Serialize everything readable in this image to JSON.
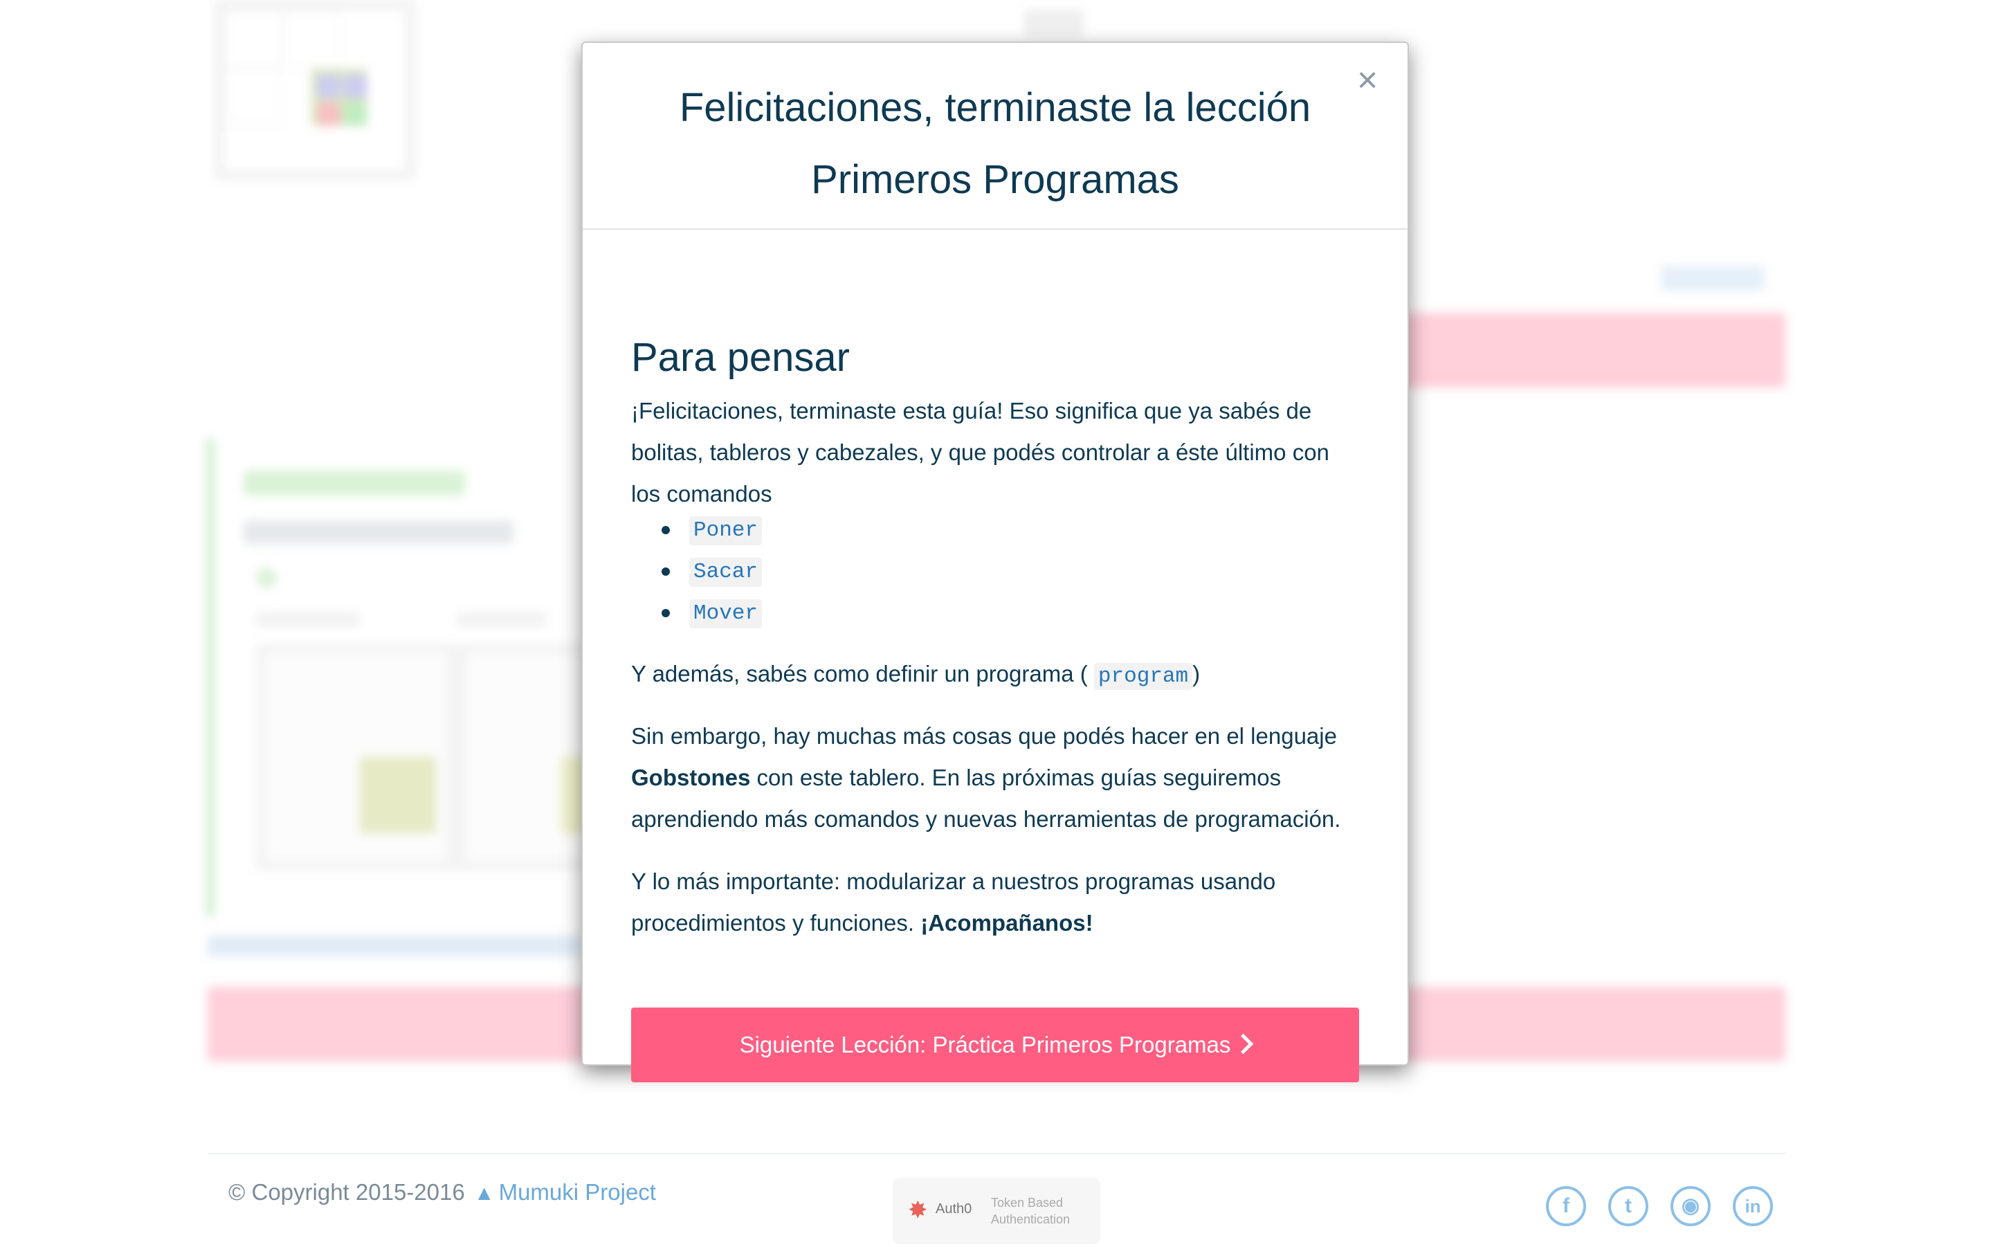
{
  "modal": {
    "title_line1": "Felicitaciones, terminaste la lección",
    "title_line2": "Primeros Programas",
    "close_label": "×",
    "section_title": "Para pensar",
    "paragraph1": "¡Felicitaciones, terminaste esta guía! Eso significa que ya sabés de bolitas, tableros y cabezales, y que podés controlar a éste último con los comandos",
    "commands": [
      "Poner",
      "Sacar",
      "Mover"
    ],
    "paragraph2_prefix": "Y además, sabés como definir un programa (",
    "paragraph2_code": "program",
    "paragraph2_suffix": ")",
    "paragraph3_prefix": "Sin embargo, hay muchas más cosas que podés hacer en el lenguaje ",
    "paragraph3_bold": "Gobstones",
    "paragraph3_suffix": " con este tablero. En las próximas guías seguiremos aprendiendo más comandos y nuevas herramientas de programación.",
    "paragraph4_prefix": "Y lo más importante: modularizar a nuestros programas usando procedimientos y funciones. ",
    "paragraph4_bold": "¡Acompañanos!",
    "next_button_label": "Siguiente Lección: Práctica Primeros Programas"
  },
  "footer": {
    "copyright_text": "© Copyright 2015-2016",
    "project_link": "Mumuki Project",
    "auth0_name": "Auth0",
    "auth0_desc_line1": "Token Based",
    "auth0_desc_line2": "Authentication",
    "social": [
      {
        "icon": "facebook-icon",
        "glyph": "f"
      },
      {
        "icon": "twitter-icon",
        "glyph": "t"
      },
      {
        "icon": "github-icon",
        "glyph": "◉"
      },
      {
        "icon": "linkedin-icon",
        "glyph": "in"
      }
    ]
  },
  "colors": {
    "primary_text": "#0e3a52",
    "accent_button": "#ff5d82",
    "code_text": "#2676b8",
    "link": "#6aa8d8"
  }
}
